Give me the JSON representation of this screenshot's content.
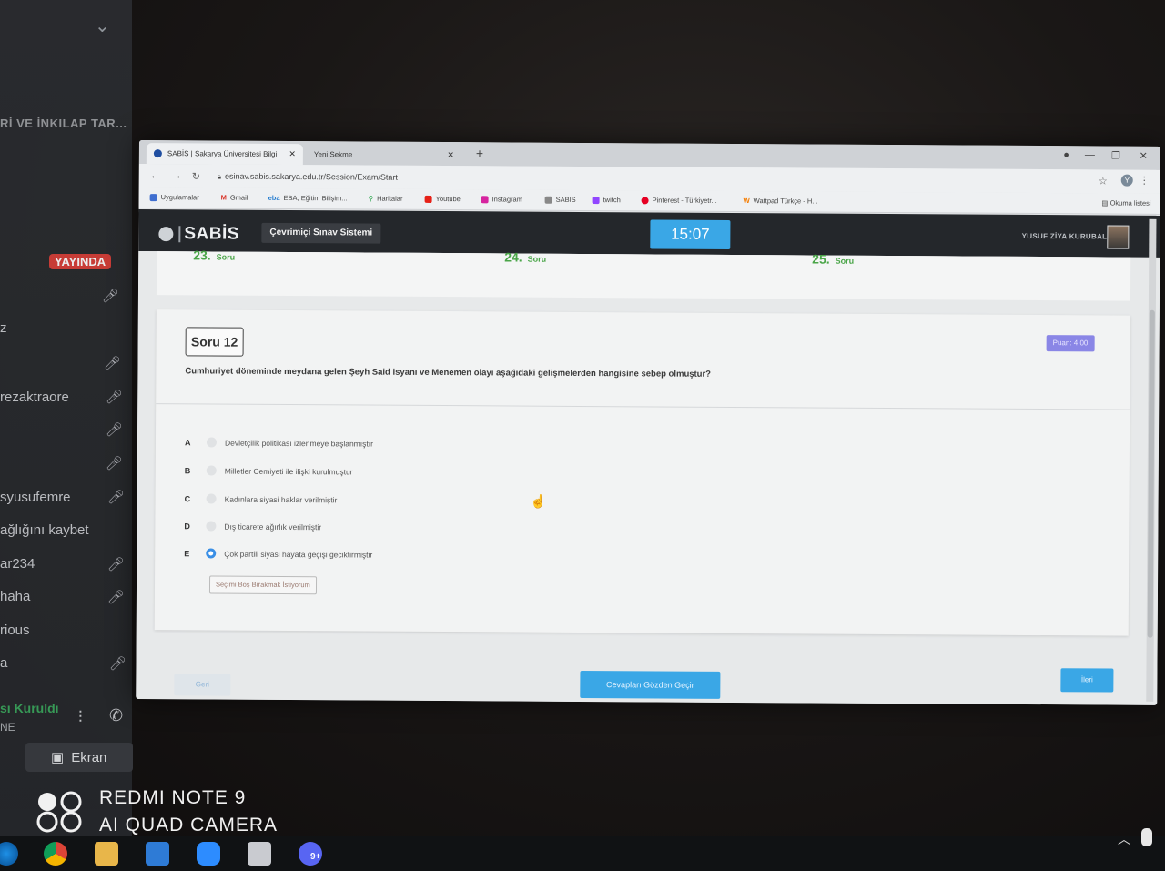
{
  "sidebar": {
    "section_title": "Rİ VE İNKILAP TAR...",
    "live_badge": "YAYINDA",
    "users": [
      "z",
      "rezaktraore",
      "syusufemre",
      "ağlığını kaybet",
      "ar234",
      "haha",
      "rious",
      "a"
    ],
    "voice_status": "sı Kuruldı",
    "voice_sub": "NE",
    "screen_button": "Ekran"
  },
  "browser": {
    "tab_active": "SABİS | Sakarya Üniversitesi Bilgi",
    "tab_new": "Yeni Sekme",
    "url": "esinav.sabis.sakarya.edu.tr/Session/Exam/Start",
    "profile_initial": "Y",
    "bookmarks": [
      "Uygulamalar",
      "Gmail",
      "EBA, Eğitim Bilişim...",
      "Haritalar",
      "Youtube",
      "Instagram",
      "SABIS",
      "twitch",
      "Pinterest - Türkiyetr...",
      "Wattpad Türkçe - H..."
    ],
    "reading_list": "Okuma listesi"
  },
  "sabis": {
    "logo": "SABİS",
    "system_name": "Çevrimiçi Sınav Sistemi",
    "timer": "15:07",
    "user_name": "YUSUF ZİYA KURUBAL",
    "prev_questions": [
      {
        "num": "23.",
        "label": "Soru"
      },
      {
        "num": "24.",
        "label": "Soru"
      },
      {
        "num": "25.",
        "label": "Soru"
      }
    ],
    "question": {
      "label": "Soru 12",
      "points": "Puan: 4,00",
      "text": "Cumhuriyet döneminde meydana gelen Şeyh Said isyanı ve Menemen olayı aşağıdaki gelişmelerden hangisine sebep olmuştur?",
      "options": [
        {
          "letter": "A",
          "text": "Devletçilik politikası izlenmeye başlanmıştır",
          "selected": false
        },
        {
          "letter": "B",
          "text": "Milletler Cemiyeti ile ilişki kurulmuştur",
          "selected": false
        },
        {
          "letter": "C",
          "text": "Kadınlara siyasi haklar verilmiştir",
          "selected": false
        },
        {
          "letter": "D",
          "text": "Dış ticarete ağırlık verilmiştir",
          "selected": false
        },
        {
          "letter": "E",
          "text": "Çok partili siyasi hayata geçişi geciktirmiştir",
          "selected": true
        }
      ],
      "blank_button": "Seçimi Boş Bırakmak İstiyorum"
    },
    "buttons": {
      "prev": "Geri",
      "review": "Cevapları Gözden Geçir",
      "next": "İleri"
    }
  },
  "watermark": {
    "line1": "REDMI NOTE 9",
    "line2": "AI QUAD CAMERA"
  },
  "taskbar": {
    "badge": "9+"
  }
}
